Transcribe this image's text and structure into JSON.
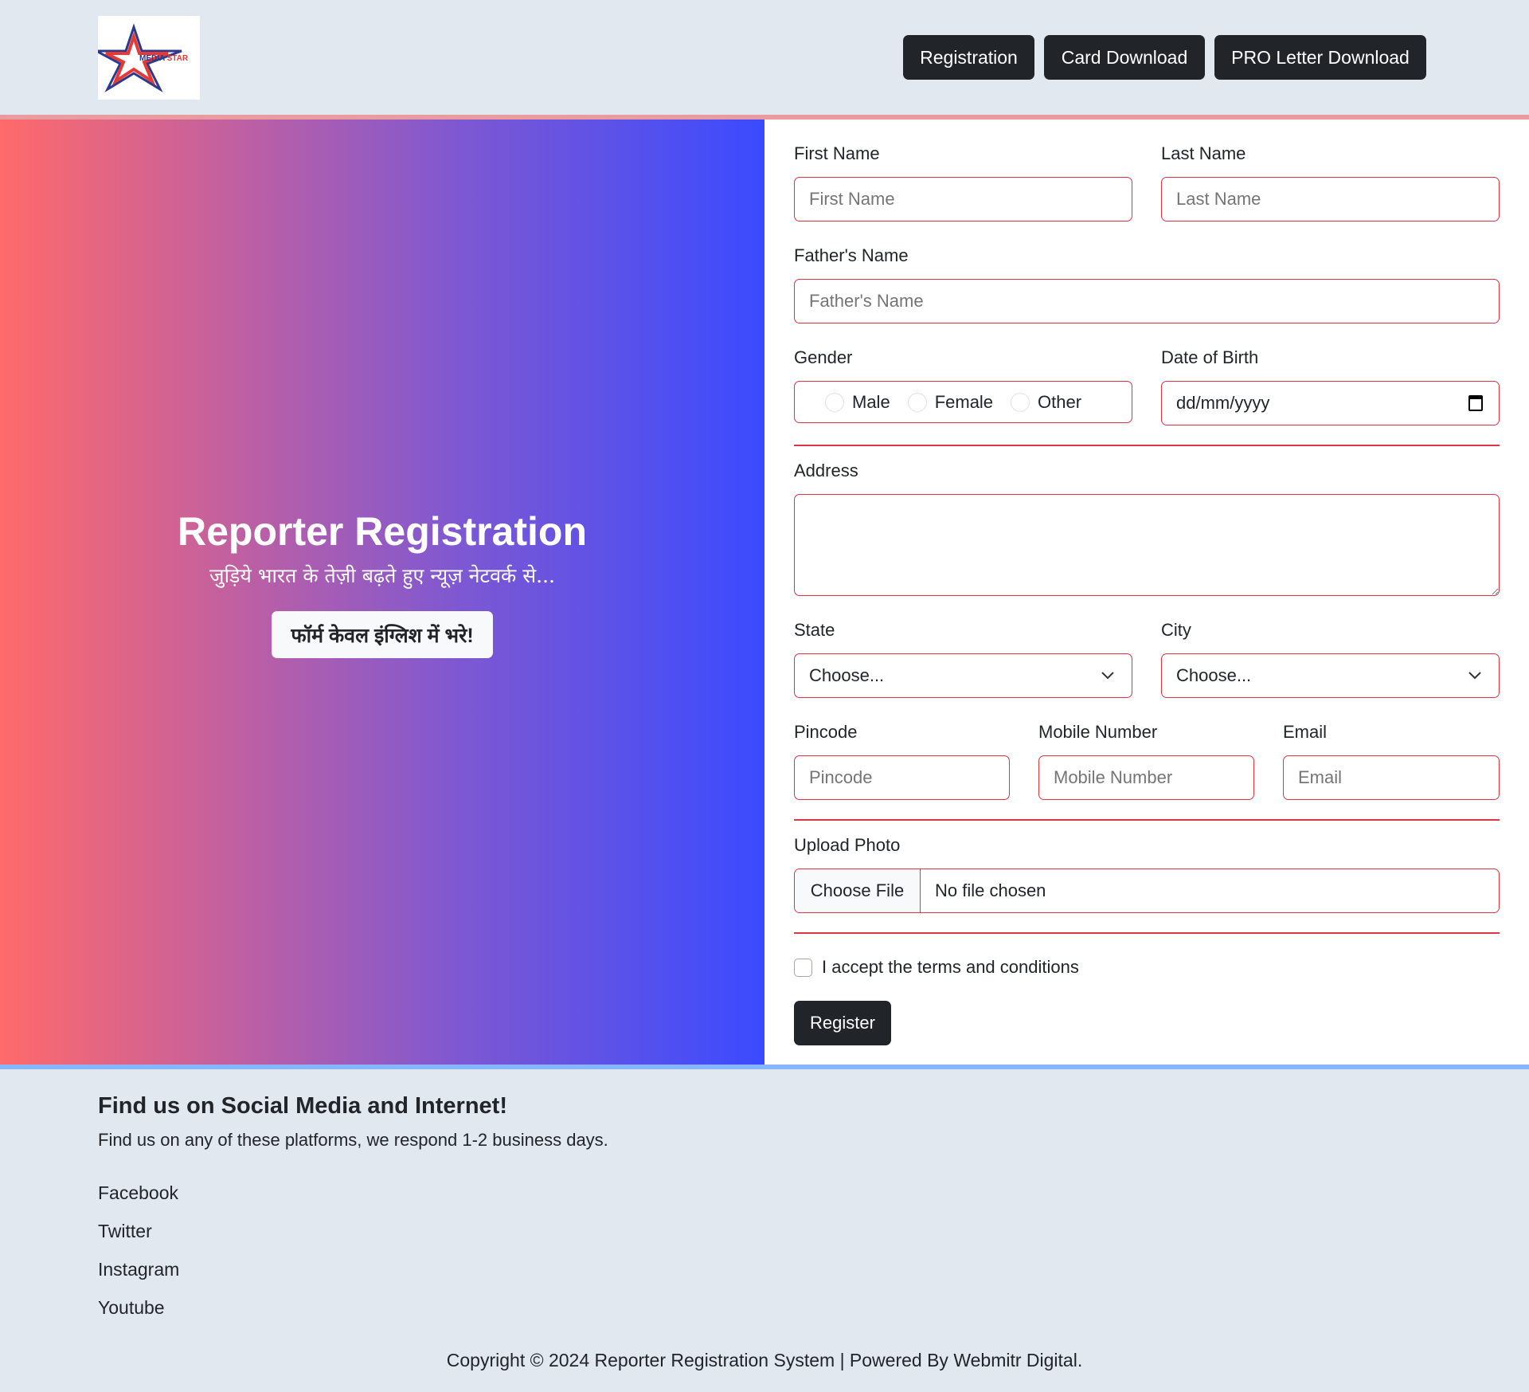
{
  "header": {
    "logo_text": "MEDIA STAR",
    "nav": [
      "Registration",
      "Card Download",
      "PRO Letter Download"
    ]
  },
  "hero": {
    "title": "Reporter Registration",
    "subtitle": "जुड़िये भारत के तेज़ी बढ़ते हुए न्यूज़ नेटवर्क से...",
    "note": "फॉर्म केवल इंग्लिश में भरे!"
  },
  "form": {
    "first_name": {
      "label": "First Name",
      "placeholder": "First Name"
    },
    "last_name": {
      "label": "Last Name",
      "placeholder": "Last Name"
    },
    "father": {
      "label": "Father's Name",
      "placeholder": "Father's Name"
    },
    "gender": {
      "label": "Gender",
      "options": [
        "Male",
        "Female",
        "Other"
      ]
    },
    "dob": {
      "label": "Date of Birth",
      "placeholder": "dd/mm/yyyy"
    },
    "address": {
      "label": "Address"
    },
    "state": {
      "label": "State",
      "value": "Choose..."
    },
    "city": {
      "label": "City",
      "value": "Choose..."
    },
    "pincode": {
      "label": "Pincode",
      "placeholder": "Pincode"
    },
    "mobile": {
      "label": "Mobile Number",
      "placeholder": "Mobile Number"
    },
    "email": {
      "label": "Email",
      "placeholder": "Email"
    },
    "photo": {
      "label": "Upload Photo",
      "button": "Choose File",
      "status": "No file chosen"
    },
    "terms": "I accept the terms and conditions",
    "submit": "Register"
  },
  "footer": {
    "heading": "Find us on Social Media and Internet!",
    "text": "Find us on any of these platforms, we respond 1-2 business days.",
    "links": [
      "Facebook",
      "Twitter",
      "Instagram",
      "Youtube"
    ],
    "copyright": "Copyright © 2024 Reporter Registration System | Powered By Webmitr Digital."
  }
}
